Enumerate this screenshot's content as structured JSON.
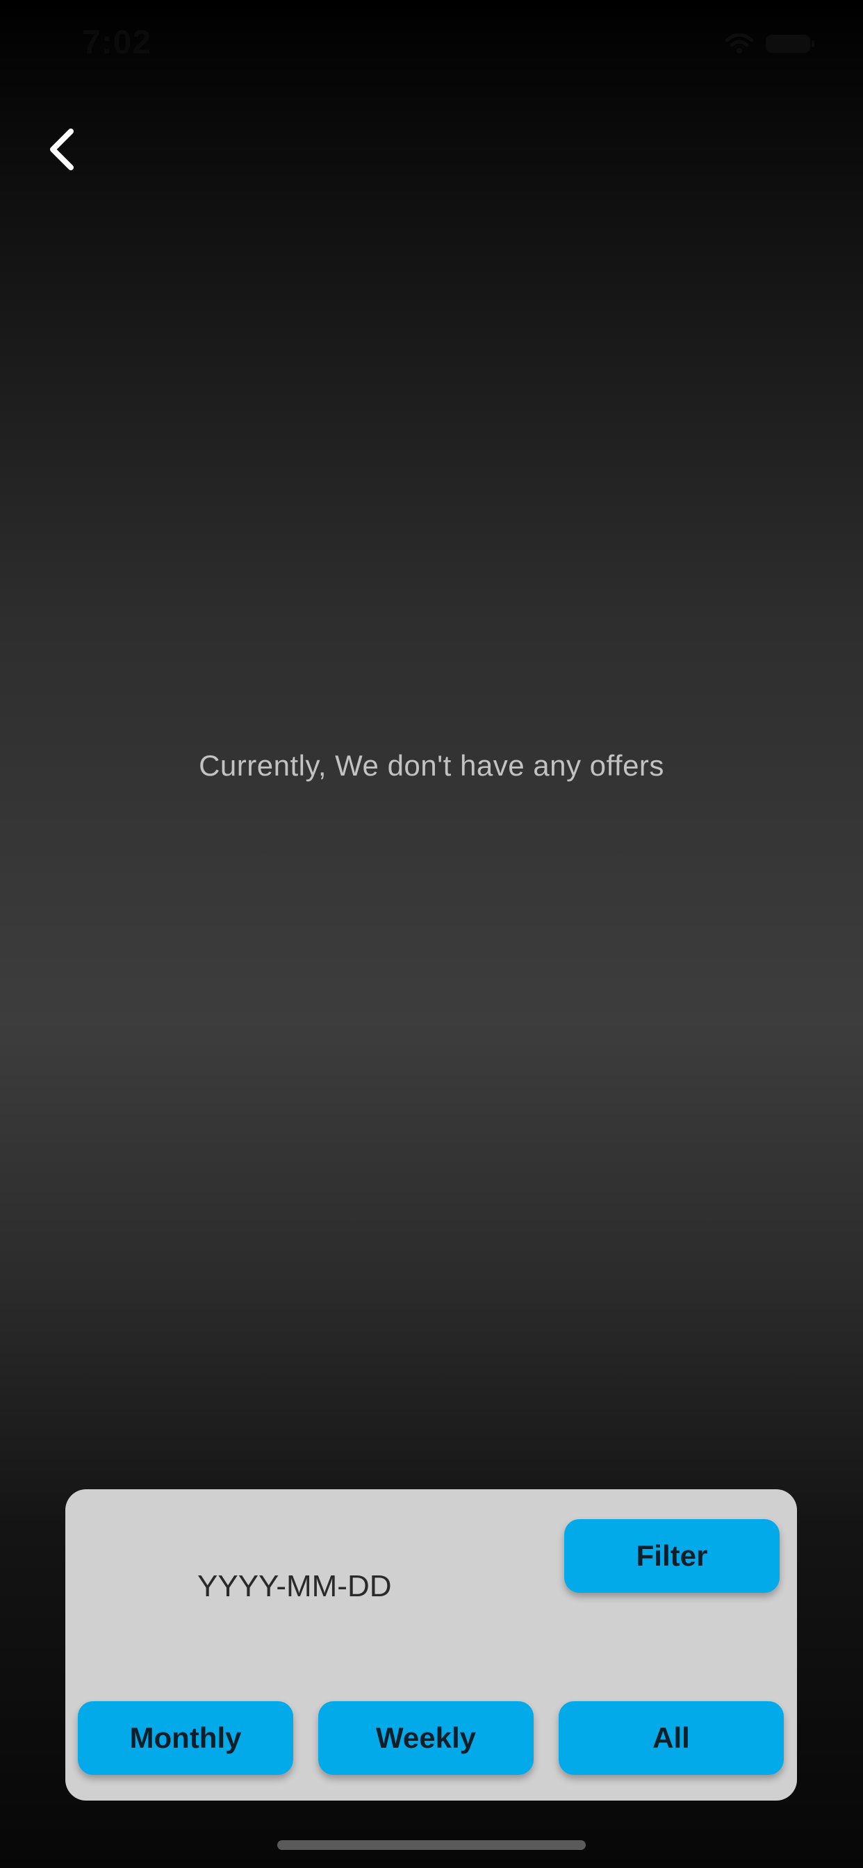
{
  "status_bar": {
    "time": "7:02",
    "icons": [
      "wifi-icon",
      "battery-icon"
    ]
  },
  "header": {
    "back_icon": "chevron-left-icon"
  },
  "empty_state": {
    "message": "Currently, We don't have any offers"
  },
  "filter_panel": {
    "date_placeholder": "YYYY-MM-DD",
    "filter_label": "Filter",
    "range_buttons": {
      "monthly": "Monthly",
      "weekly": "Weekly",
      "all": "All"
    }
  },
  "colors": {
    "accent": "#03aae9",
    "panel": "#d0d0d0",
    "message_text": "#c2c2c2",
    "background_mid": "#3d3d3d"
  }
}
